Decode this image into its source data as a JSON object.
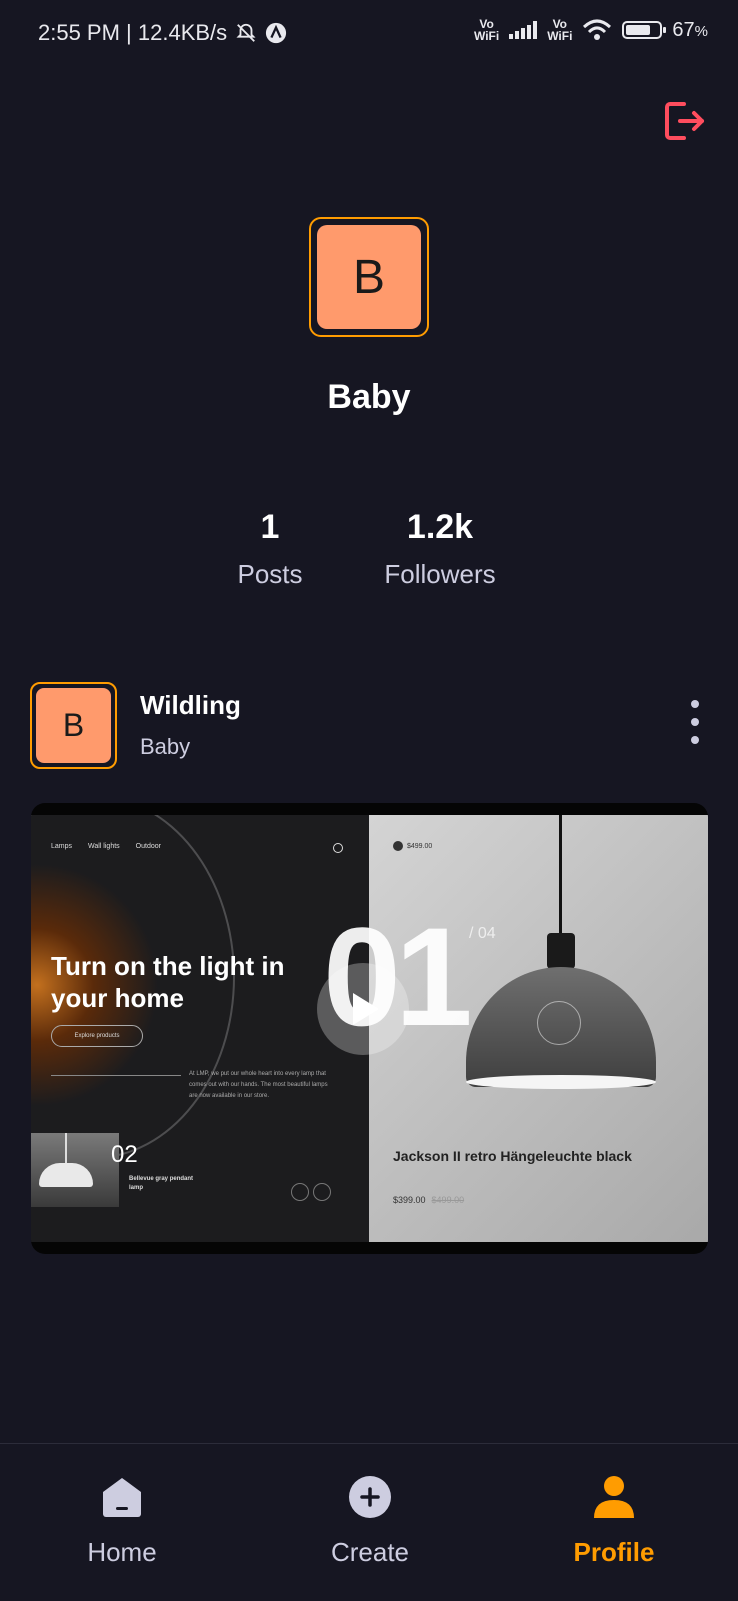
{
  "status_bar": {
    "time_speed": "2:55 PM | 12.4KB/s",
    "volte1": "Vo\nWiFi",
    "volte2": "Vo\nWiFi",
    "battery": "67",
    "battery_unit": "%"
  },
  "profile": {
    "avatar_initial": "B",
    "name": "Baby",
    "stats": [
      {
        "value": "1",
        "label": "Posts"
      },
      {
        "value": "1.2k",
        "label": "Followers"
      }
    ]
  },
  "post": {
    "avatar_initial": "B",
    "title": "Wildling",
    "creator": "Baby",
    "thumbnail": {
      "nav_links": [
        "Lamps",
        "Wall lights",
        "Outdoor"
      ],
      "hero_text": "Turn on the light in your home",
      "explore_button": "Explore products",
      "copy": "At LMP, we put our whole heart into every lamp that comes out with our hands. The most beautiful lamps are now available in our store.",
      "secondary_number": "02",
      "secondary_name": "Bellevue gray pendant lamp",
      "top_price": "$499.00",
      "big_number": "01",
      "total": "/ 04",
      "product_name": "Jackson II retro Hängeleuchte black",
      "product_price": "$399.00",
      "product_old_price": "$499.00"
    }
  },
  "tabs": [
    {
      "label": "Home",
      "icon": "home-icon",
      "active": false
    },
    {
      "label": "Create",
      "icon": "plus-circle-icon",
      "active": false
    },
    {
      "label": "Profile",
      "icon": "user-icon",
      "active": true
    }
  ],
  "colors": {
    "background": "#161622",
    "accent": "#ff9c01",
    "avatar_bg": "#ff9a6c",
    "logout": "#ff4d5e"
  }
}
